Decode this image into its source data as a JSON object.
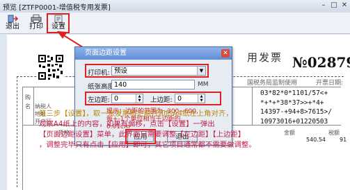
{
  "window": {
    "title": "预览 [ZTFP0001-增值税专用发票]",
    "controls": {
      "min": "–",
      "max": "□",
      "close": "✕"
    }
  },
  "toolbar": {
    "exit_label": "退出",
    "print_label": "打印",
    "settings_label": "设置"
  },
  "invoice": {
    "title_partial": "用发票",
    "number_partial": "№02879",
    "sub_label": "国税务局监制使用",
    "date_label": "开票日期:",
    "cipher_lines": [
      "03*82*0*1101/57<+",
      "*+*+*38*37>>+*4+",
      "14397-+94+8>7615>/",
      "10973016+01220503"
    ],
    "left_labels": [
      "购",
      "名",
      "纳税人",
      "地址",
      "开户行"
    ],
    "goods_label": "货物",
    "amount_header": "金额",
    "tax_header": "税额",
    "amount_value": "540.54",
    "tax_value": "91"
  },
  "dialog": {
    "title": "页面边距设置",
    "close": "✕",
    "printer_label": "打印机:",
    "printer_value": "预设",
    "paper_height_label": "纸张高度:",
    "paper_height_value": "140",
    "paper_height_unit": "MM",
    "left_margin_label": "左边距:",
    "left_margin_value": "0",
    "top_margin_label": "上边距:",
    "top_margin_value": "0",
    "hint_line1": "提示：边距的范围为 -300~600,",
    "hint_line2": "每+-1个单位相当于边距的0.01cm",
    "apply_label": "应用",
    "exit_label": "退出"
  },
  "instructions": [
    "第三步【设置】，取一张发票和之前打印的A4纸左上角对齐，",
    "观察A4纸上的内容，如果有偏移，点击【设置】一弹出",
    "【页面边距设置】菜单，此界面只需要调整【左边距】【上边距】",
    "，调整完毕只有点击【应用】即可，其它项目通常都不需要做调整。"
  ]
}
